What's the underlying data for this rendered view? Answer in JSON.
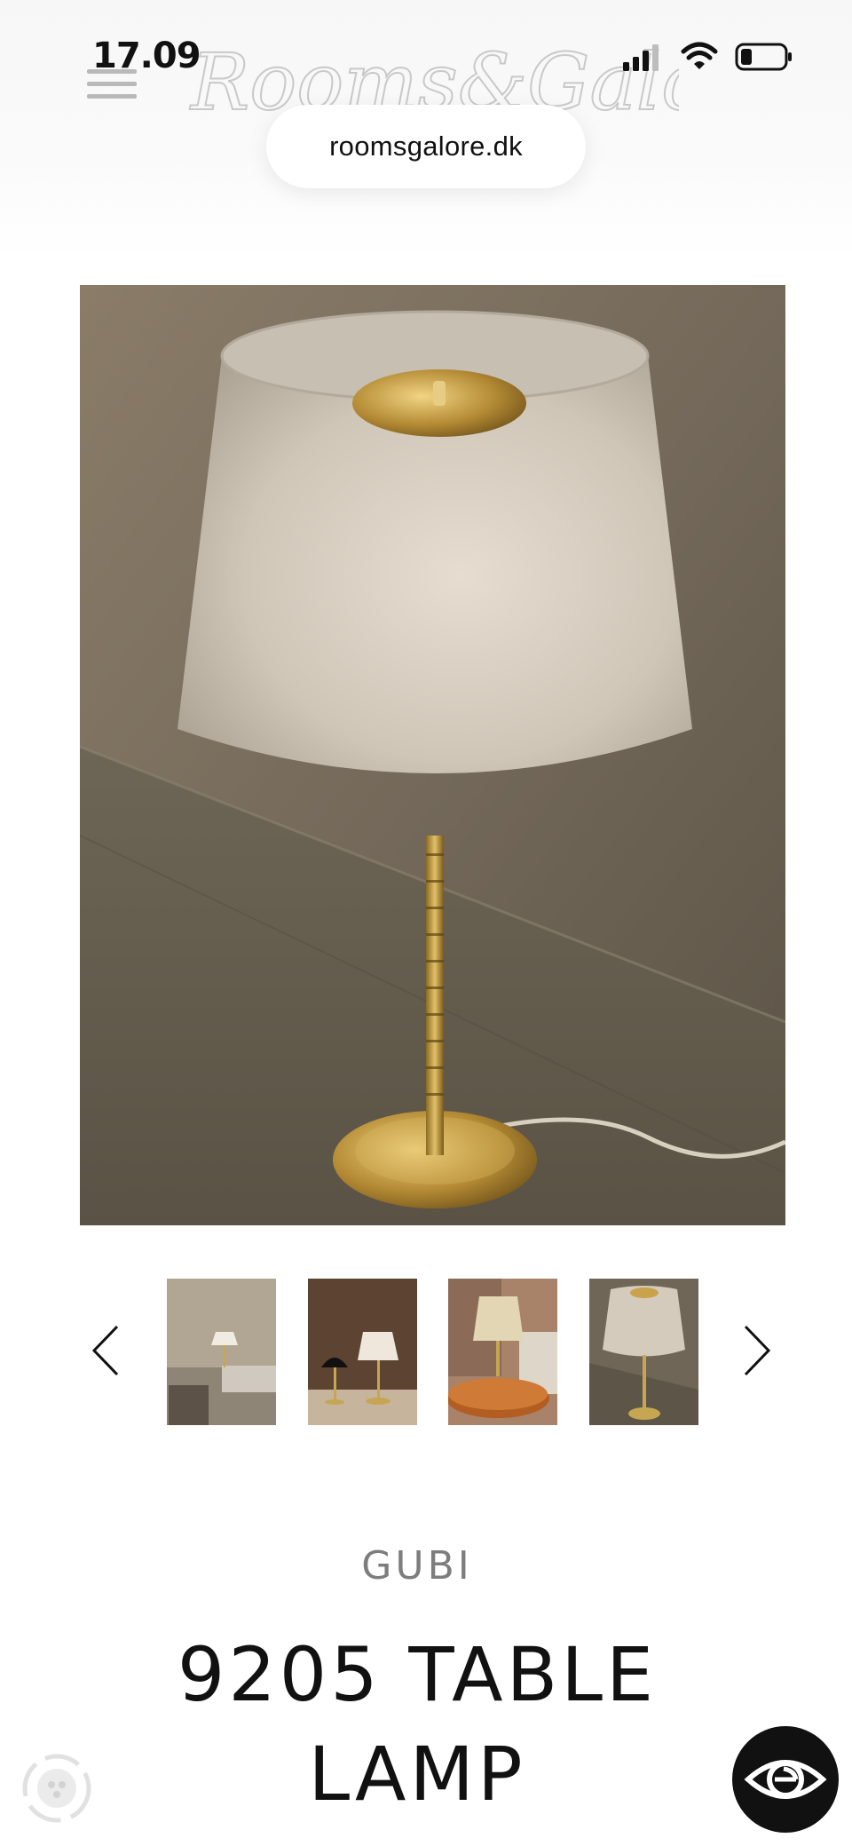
{
  "status_bar": {
    "time": "17.09",
    "icons": [
      "signal-icon",
      "wifi-icon",
      "battery-icon"
    ]
  },
  "header": {
    "logo_text": "Rooms&Galore",
    "menu_icon": "hamburger-menu-icon",
    "url": "roomsgalore.dk"
  },
  "gallery": {
    "main_image_alt": "9205 table lamp with linen shade and brass stem",
    "prev_icon": "chevron-left-icon",
    "next_icon": "chevron-right-icon",
    "thumbnails": [
      {
        "alt": "Lamp in living room with sofa"
      },
      {
        "alt": "Two lamps on dark background"
      },
      {
        "alt": "Lamp on round wooden table against brick wall"
      },
      {
        "alt": "Lamp close-up with linen shade"
      }
    ]
  },
  "product": {
    "brand": "GUBI",
    "title_line1": "9205 TABLE",
    "title_line2": "LAMP"
  },
  "floating": {
    "chat_icon": "chat-badge-icon",
    "accessibility_icon": "eye-icon"
  },
  "colors": {
    "brand_gray": "#7d7d7d",
    "text": "#111111",
    "background": "#ffffff"
  }
}
